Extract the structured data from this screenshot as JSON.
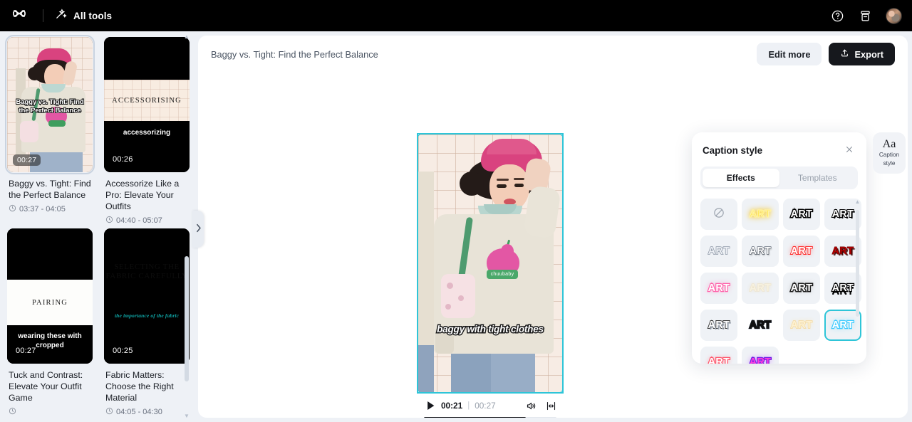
{
  "topbar": {
    "logo_icon": "capcut-logo-icon",
    "all_tools_label": "All tools",
    "magic_icon": "magic-wand-icon",
    "help_icon": "help-circle-icon",
    "archive_icon": "archive-box-icon",
    "avatar_icon": "user-avatar"
  },
  "sidebar": {
    "cards": [
      {
        "title": "Baggy vs. Tight: Find the Perfect Balance",
        "duration": "00:27",
        "timerange": "03:37 - 04:05",
        "overlay_text": "Baggy vs. Tight: Find the Perfect Balance",
        "selected": true
      },
      {
        "title": "Accessorize Like a Pro: Elevate Your Outfits",
        "duration": "00:26",
        "timerange": "04:40 - 05:07",
        "band_text": "ACCESSORISING",
        "lower_text": "accessorizing",
        "selected": false
      },
      {
        "title": "Tuck and Contrast: Elevate Your Outfit Game",
        "duration": "00:27",
        "timerange": "",
        "band_text": "PAIRING",
        "lower_text": "wearing these with cropped",
        "selected": false
      },
      {
        "title": "Fabric Matters: Choose the Right Material",
        "duration": "00:25",
        "timerange": "04:05 - 04:30",
        "ghost_text": "SELECTING THE FABRIC CAREFULLY",
        "teal_text": "the importance of the fabric",
        "selected": false
      }
    ],
    "clock_icon": "clock-icon",
    "collapse_icon": "chevron-right-icon",
    "scroll_up_icon": "scroll-up-arrow",
    "scroll_down_icon": "scroll-down-arrow"
  },
  "main": {
    "title": "Baggy vs. Tight: Find the Perfect Balance",
    "edit_more_label": "Edit more",
    "export_label": "Export",
    "export_icon": "upload-icon"
  },
  "player": {
    "caption_text": "baggy with tight clothes",
    "current_time": "00:21",
    "separator": "|",
    "total_time": "00:27",
    "progress_percent": 77,
    "play_icon": "play-icon",
    "volume_icon": "volume-on-icon",
    "fullscreen_icon": "expand-icon",
    "handle_icon": "resize-handle"
  },
  "caption_style": {
    "title": "Caption style",
    "close_icon": "close-icon",
    "tabs": [
      {
        "label": "Effects",
        "active": true
      },
      {
        "label": "Templates",
        "active": false
      }
    ],
    "sample_text": "ART",
    "none_icon": "no-effect-icon",
    "effects": [
      {
        "id": "none",
        "label": "",
        "class": "sw-none",
        "selected": false
      },
      {
        "id": "yellow-glow",
        "label": "ART",
        "class": "e1",
        "selected": false
      },
      {
        "id": "black-outline",
        "label": "ART",
        "class": "e2",
        "selected": false
      },
      {
        "id": "drop-shadow",
        "label": "ART",
        "class": "e3",
        "selected": false
      },
      {
        "id": "soft-grey",
        "label": "ART",
        "class": "e4",
        "selected": false
      },
      {
        "id": "white-shadow",
        "label": "ART",
        "class": "e5",
        "selected": false
      },
      {
        "id": "red-neon",
        "label": "ART",
        "class": "e6",
        "selected": false
      },
      {
        "id": "dark-red-3d",
        "label": "ART",
        "class": "e7",
        "selected": false
      },
      {
        "id": "pink-glow",
        "label": "ART",
        "class": "e8",
        "selected": false
      },
      {
        "id": "cream-glow",
        "label": "ART",
        "class": "e9",
        "selected": false
      },
      {
        "id": "grey-glow",
        "label": "ART",
        "class": "e10",
        "selected": false
      },
      {
        "id": "black-block",
        "label": "ART",
        "class": "e11",
        "selected": false
      },
      {
        "id": "grey-offset",
        "label": "ART",
        "class": "e12",
        "selected": false
      },
      {
        "id": "blue-gradient",
        "label": "ART",
        "class": "e13",
        "selected": false
      },
      {
        "id": "gold-glow",
        "label": "ART",
        "class": "e14",
        "selected": false
      },
      {
        "id": "cyan-glow",
        "label": "ART",
        "class": "e15",
        "selected": true
      },
      {
        "id": "coral-glow",
        "label": "ART",
        "class": "e16",
        "selected": false
      },
      {
        "id": "purple-neon",
        "label": "ART",
        "class": "e17",
        "selected": false
      }
    ],
    "scroll_up_icon": "scroll-up-arrow",
    "scroll_down_icon": "scroll-down-arrow"
  },
  "tool_rail": {
    "caption_style_glyph": "Aa",
    "caption_style_label_line1": "Caption",
    "caption_style_label_line2": "style"
  }
}
